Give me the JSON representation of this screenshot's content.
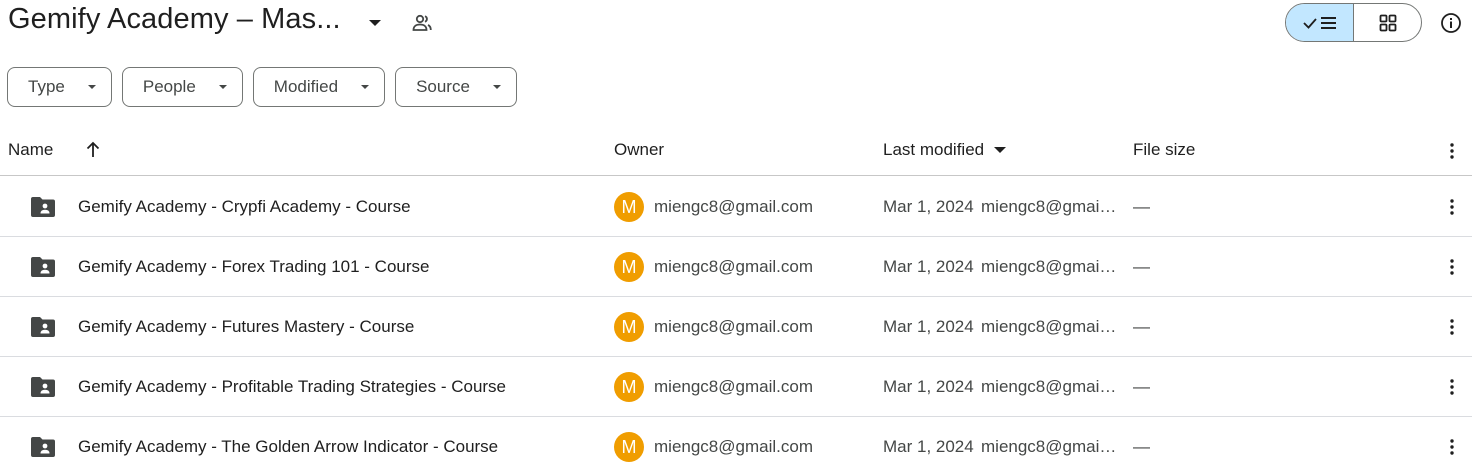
{
  "header": {
    "title": "Gemify Academy – Mas...",
    "view_list_icon": "check-list-icon",
    "view_grid_icon": "grid-icon",
    "info_icon": "info-icon"
  },
  "filters": [
    "Type",
    "People",
    "Modified",
    "Source"
  ],
  "table": {
    "columns": {
      "name": "Name",
      "owner": "Owner",
      "last_modified": "Last modified",
      "file_size": "File size"
    },
    "rows": [
      {
        "name": "Gemify Academy - Crypfi Academy - Course",
        "owner_initial": "M",
        "owner": "miengc8@gmail.com",
        "date": "Mar 1, 2024",
        "modified_by": "miengc8@gmail.com",
        "size": "—"
      },
      {
        "name": "Gemify Academy - Forex Trading 101 - Course",
        "owner_initial": "M",
        "owner": "miengc8@gmail.com",
        "date": "Mar 1, 2024",
        "modified_by": "miengc8@gmail.com",
        "size": "—"
      },
      {
        "name": "Gemify Academy - Futures Mastery - Course",
        "owner_initial": "M",
        "owner": "miengc8@gmail.com",
        "date": "Mar 1, 2024",
        "modified_by": "miengc8@gmail.com",
        "size": "—"
      },
      {
        "name": "Gemify Academy - Profitable Trading Strategies - Course",
        "owner_initial": "M",
        "owner": "miengc8@gmail.com",
        "date": "Mar 1, 2024",
        "modified_by": "miengc8@gmail.com",
        "size": "—"
      },
      {
        "name": "Gemify Academy - The Golden Arrow Indicator - Course",
        "owner_initial": "M",
        "owner": "miengc8@gmail.com",
        "date": "Mar 1, 2024",
        "modified_by": "miengc8@gmail.com",
        "size": "—"
      }
    ]
  },
  "colors": {
    "avatar": "#f09d00",
    "view_selected": "#c2e7ff"
  }
}
